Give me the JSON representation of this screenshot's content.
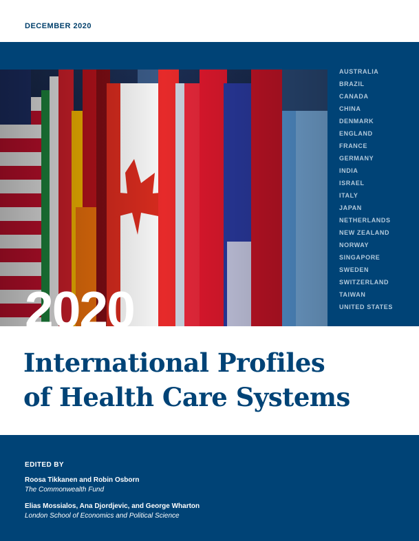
{
  "header": {
    "date": "DECEMBER 2020"
  },
  "countries": [
    "AUSTRALIA",
    "BRAZIL",
    "CANADA",
    "CHINA",
    "DENMARK",
    "ENGLAND",
    "FRANCE",
    "GERMANY",
    "INDIA",
    "ISRAEL",
    "ITALY",
    "JAPAN",
    "NETHERLANDS",
    "NEW ZEALAND",
    "NORWAY",
    "SINGAPORE",
    "SWEDEN",
    "SWITZERLAND",
    "TAIWAN",
    "UNITED STATES"
  ],
  "cover": {
    "year": "2020",
    "title_line1": "International Profiles",
    "title_line2": "of Health Care Systems"
  },
  "editors": {
    "heading": "EDITED BY",
    "groups": [
      {
        "names": "Roosa Tikkanen and Robin Osborn",
        "org": "The Commonwealth Fund"
      },
      {
        "names": "Elias Mossialos, Ana Djordjevic, and George Wharton",
        "org": "London School of Economics and  Political Science"
      }
    ]
  },
  "colors": {
    "navy": "#004376",
    "white": "#ffffff",
    "country_text": "#b3cadc"
  }
}
